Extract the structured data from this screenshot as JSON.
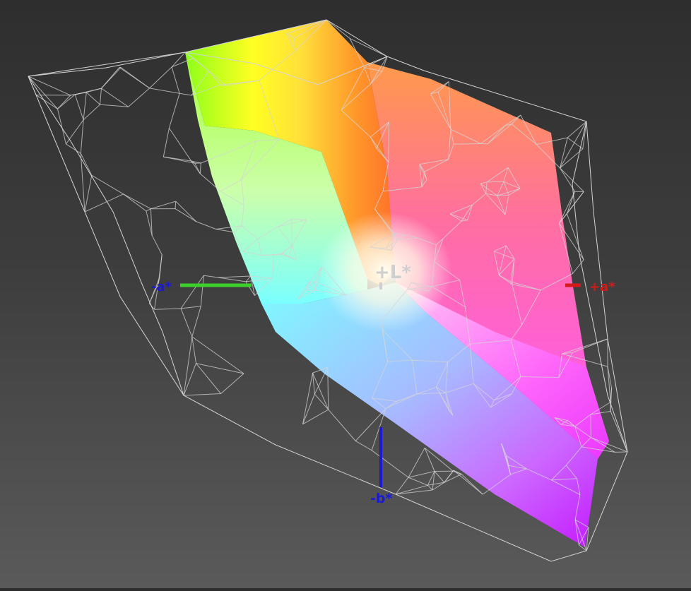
{
  "axes": {
    "plus_l": {
      "label": "+L*",
      "color": "#cfcfcf"
    },
    "minus_a": {
      "label": "-a*",
      "color": "#1a1ad6",
      "line_color": "#3ad12a"
    },
    "plus_a": {
      "label": "+a*",
      "color": "#d61a1a",
      "line_color": "#d61a1a"
    },
    "minus_b": {
      "label": "-b*",
      "color": "#1a1ad6",
      "line_color": "#1a1ad6"
    }
  },
  "colors": {
    "background_top": "#2e2e2e",
    "background_bottom": "#5a5a5a",
    "wireframe": "#d4d4d4",
    "gamut_yellow": "#ffff00",
    "gamut_green": "#8cff1a",
    "gamut_orange": "#ff8a1a",
    "gamut_magenta": "#ff33ff",
    "gamut_violet": "#c41aff",
    "gamut_cyan": "#66ffff",
    "gamut_white": "#fffef2"
  }
}
